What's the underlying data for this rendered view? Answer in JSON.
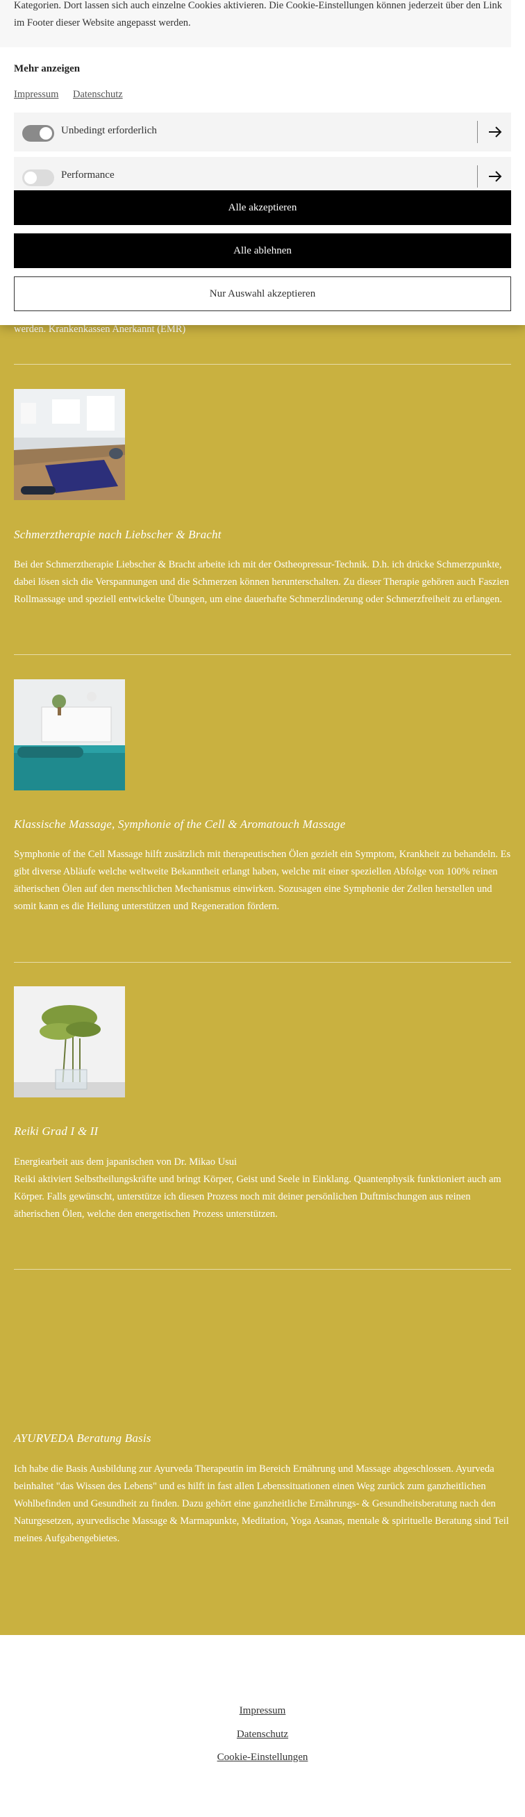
{
  "cookie_banner": {
    "intro_text": "Kategorien. Dort lassen sich auch einzelne Cookies aktivieren. Die Cookie-Einstellungen können jederzeit über den Link im Footer dieser Website angepasst werden.",
    "more_label": "Mehr anzeigen",
    "links": [
      "Impressum",
      "Datenschutz"
    ],
    "categories": [
      {
        "label": "Unbedingt erforderlich",
        "enabled": true
      },
      {
        "label": "Performance",
        "enabled": false
      }
    ],
    "buttons": {
      "accept_all": "Alle akzeptieren",
      "reject_all": "Alle ablehnen",
      "accept_selection": "Nur Auswahl akzeptieren"
    }
  },
  "content": {
    "partial_text": "werden. Krankenkassen Anerkannt (EMR)",
    "services": [
      {
        "title": "Schmerztherapie nach Liebscher & Bracht",
        "paragraphs": [
          "Bei der Schmerztherapie Liebscher & Bracht arbeite ich mit der Ostheopressur-Technik. D.h. ich drücke Schmerzpunkte, dabei lösen sich die Verspannungen und die Schmerzen können herunterschalten. Zu dieser Therapie gehören auch Faszien Rollmassage und speziell entwickelte Übungen, um eine dauerhafte Schmerzlinderung oder Schmerzfreiheit zu erlangen."
        ]
      },
      {
        "title": "Klassische Massage, Symphonie of the Cell & Aromatouch Massage",
        "paragraphs": [
          "Symphonie of the Cell Massage hilft zusätzlich mit therapeutischen Ölen gezielt ein Symptom, Krankheit zu behandeln. Es gibt diverse Abläufe welche weltweite Bekanntheit erlangt haben, welche mit einer speziellen Abfolge von 100% reinen ätherischen Ölen auf den menschlichen Mechanismus einwirken. Sozusagen eine Symphonie der Zellen herstellen und somit kann es die Heilung unterstützen und Regeneration fördern."
        ]
      },
      {
        "title": "Reiki Grad I & II",
        "paragraphs": [
          "Energiearbeit aus dem japanischen von Dr. Mikao Usui",
          "Reiki aktiviert Selbstheilungskräfte und bringt Körper, Geist und Seele in Einklang. Quantenphysik funktioniert auch am Körper. Falls gewünscht, unterstütze ich diesen Prozess noch mit deiner persönlichen Duftmischungen aus reinen ätherischen Ölen, welche den energetischen Prozess unterstützen."
        ]
      },
      {
        "title": "AYURVEDA Beratung Basis",
        "paragraphs": [
          "Ich habe die Basis Ausbildung zur Ayurveda Therapeutin im Bereich Ernährung und Massage abgeschlossen. Ayurveda beinhaltet \"das Wissen des Lebens\" und es hilft in fast allen Lebenssituationen einen Weg zurück zum ganzheitlichen Wohlbefinden und Gesundheit zu finden. Dazu gehört eine ganzheitliche Ernährungs- & Gesundheitsberatung nach den Naturgesetzen, ayurvedische Massage & Marmapunkte, Meditation, Yoga Asanas, mentale & spirituelle Beratung sind Teil meines Aufgabengebietes."
        ]
      }
    ]
  },
  "footer": {
    "links": [
      "Impressum",
      "Datenschutz",
      "Cookie-Einstellungen"
    ]
  },
  "colors": {
    "page_background": "#c9b140",
    "button_dark": "#000000",
    "footer_background": "#ffffff"
  },
  "icons": [
    "arrow-right-icon",
    "toggle-switch"
  ]
}
